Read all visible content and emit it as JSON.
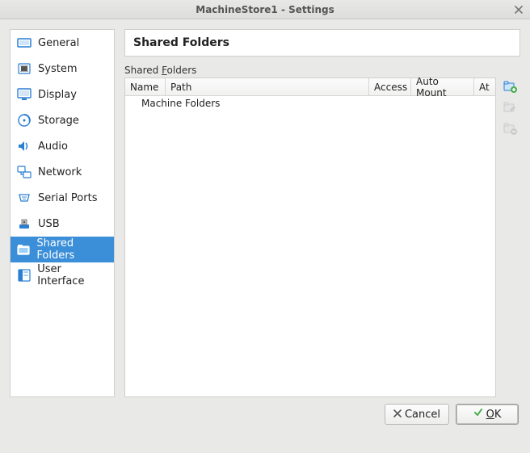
{
  "window": {
    "title": "MachineStore1 - Settings"
  },
  "sidebar": {
    "items": [
      {
        "label": "General",
        "icon": "general"
      },
      {
        "label": "System",
        "icon": "system"
      },
      {
        "label": "Display",
        "icon": "display"
      },
      {
        "label": "Storage",
        "icon": "storage"
      },
      {
        "label": "Audio",
        "icon": "audio"
      },
      {
        "label": "Network",
        "icon": "network"
      },
      {
        "label": "Serial Ports",
        "icon": "serial"
      },
      {
        "label": "USB",
        "icon": "usb"
      },
      {
        "label": "Shared Folders",
        "icon": "shared",
        "selected": true
      },
      {
        "label": "User Interface",
        "icon": "ui"
      }
    ]
  },
  "page": {
    "title": "Shared Folders",
    "section_prefix": "Shared ",
    "section_underlined": "F",
    "section_suffix": "olders",
    "columns": {
      "name": "Name",
      "path": "Path",
      "access": "Access",
      "auto_mount": "Auto Mount",
      "at": "At"
    },
    "group_row": "Machine Folders"
  },
  "side_buttons": {
    "add": "add-shared-folder",
    "edit": "edit-shared-folder",
    "remove": "remove-shared-folder"
  },
  "buttons": {
    "cancel": "Cancel",
    "ok_underlined": "O",
    "ok_rest": "K"
  }
}
